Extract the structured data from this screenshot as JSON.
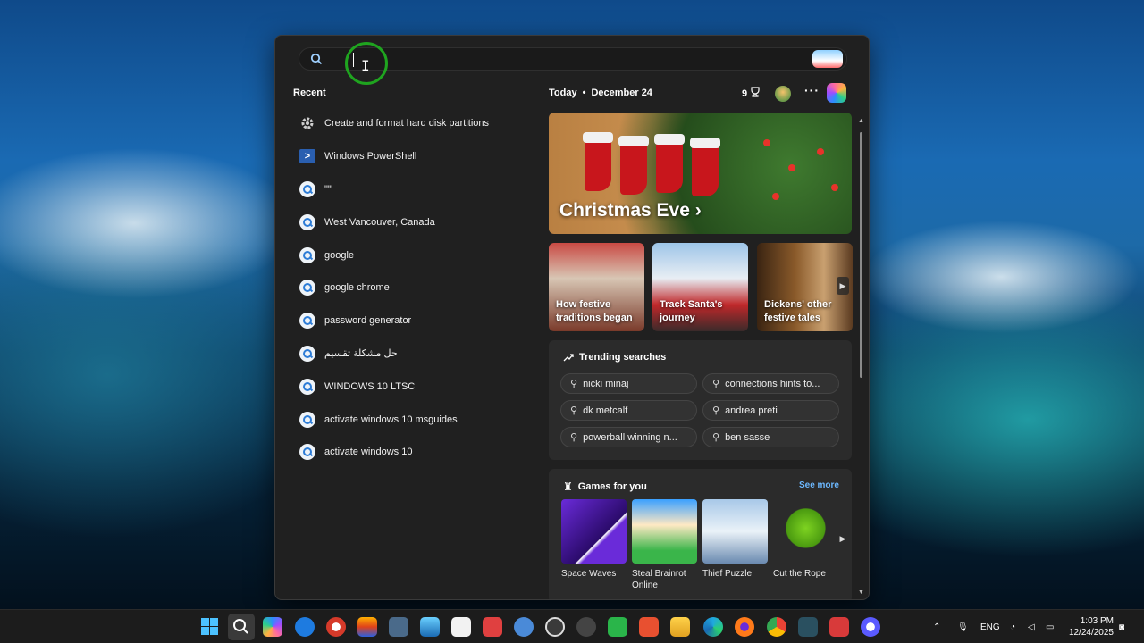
{
  "search": {
    "value": "",
    "placeholder": ""
  },
  "recent": {
    "title": "Recent",
    "items": [
      {
        "label": "Create and format hard disk partitions",
        "icon": "gear-icon"
      },
      {
        "label": "Windows PowerShell",
        "icon": "powershell-icon"
      },
      {
        "label": "\"\"",
        "icon": "search-result-icon"
      },
      {
        "label": "West Vancouver, Canada",
        "icon": "search-result-icon"
      },
      {
        "label": "google",
        "icon": "search-result-icon"
      },
      {
        "label": "google chrome",
        "icon": "search-result-icon"
      },
      {
        "label": "password generator",
        "icon": "search-result-icon"
      },
      {
        "label": "حل مشكلة تقسيم",
        "icon": "search-result-icon"
      },
      {
        "label": "WINDOWS 10 LTSC",
        "icon": "search-result-icon"
      },
      {
        "label": "activate windows 10 msguides",
        "icon": "search-result-icon"
      },
      {
        "label": "activate windows 10",
        "icon": "search-result-icon"
      }
    ]
  },
  "today": {
    "label": "Today",
    "date": "December 24",
    "rewards_count": "9"
  },
  "hero": {
    "title": "Christmas Eve",
    "arrow": "›"
  },
  "cards": [
    {
      "line1": "How festive",
      "line2": "traditions began"
    },
    {
      "line1": "Track Santa's",
      "line2": "journey"
    },
    {
      "line1": "Dickens' other",
      "line2": "festive tales"
    }
  ],
  "trending": {
    "title": "Trending searches",
    "pills": [
      "nicki minaj",
      "connections hints to...",
      "dk metcalf",
      "andrea preti",
      "powerball winning n...",
      "ben sasse"
    ]
  },
  "games": {
    "title": "Games for you",
    "see_more": "See more",
    "items": [
      {
        "line1": "Space Waves",
        "line2": ""
      },
      {
        "line1": "Steal Brainrot",
        "line2": "Online"
      },
      {
        "line1": "Thief Puzzle",
        "line2": ""
      },
      {
        "line1": "Cut the Rope",
        "line2": ""
      }
    ]
  },
  "tray": {
    "language": "ENG",
    "time": "1:03 PM",
    "date": "12/24/2025"
  },
  "colors": {
    "accent": "#4cc2ff",
    "link": "#6cb8ff",
    "panel": "#202020"
  }
}
